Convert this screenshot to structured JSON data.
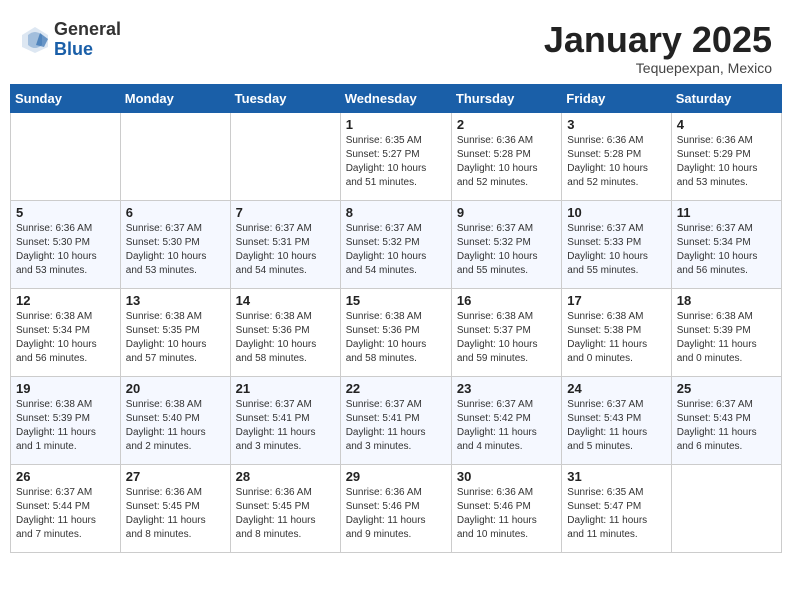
{
  "header": {
    "logo_general": "General",
    "logo_blue": "Blue",
    "month_title": "January 2025",
    "subtitle": "Tequepexpan, Mexico"
  },
  "days_of_week": [
    "Sunday",
    "Monday",
    "Tuesday",
    "Wednesday",
    "Thursday",
    "Friday",
    "Saturday"
  ],
  "weeks": [
    [
      {
        "day": "",
        "info": ""
      },
      {
        "day": "",
        "info": ""
      },
      {
        "day": "",
        "info": ""
      },
      {
        "day": "1",
        "info": "Sunrise: 6:35 AM\nSunset: 5:27 PM\nDaylight: 10 hours\nand 51 minutes."
      },
      {
        "day": "2",
        "info": "Sunrise: 6:36 AM\nSunset: 5:28 PM\nDaylight: 10 hours\nand 52 minutes."
      },
      {
        "day": "3",
        "info": "Sunrise: 6:36 AM\nSunset: 5:28 PM\nDaylight: 10 hours\nand 52 minutes."
      },
      {
        "day": "4",
        "info": "Sunrise: 6:36 AM\nSunset: 5:29 PM\nDaylight: 10 hours\nand 53 minutes."
      }
    ],
    [
      {
        "day": "5",
        "info": "Sunrise: 6:36 AM\nSunset: 5:30 PM\nDaylight: 10 hours\nand 53 minutes."
      },
      {
        "day": "6",
        "info": "Sunrise: 6:37 AM\nSunset: 5:30 PM\nDaylight: 10 hours\nand 53 minutes."
      },
      {
        "day": "7",
        "info": "Sunrise: 6:37 AM\nSunset: 5:31 PM\nDaylight: 10 hours\nand 54 minutes."
      },
      {
        "day": "8",
        "info": "Sunrise: 6:37 AM\nSunset: 5:32 PM\nDaylight: 10 hours\nand 54 minutes."
      },
      {
        "day": "9",
        "info": "Sunrise: 6:37 AM\nSunset: 5:32 PM\nDaylight: 10 hours\nand 55 minutes."
      },
      {
        "day": "10",
        "info": "Sunrise: 6:37 AM\nSunset: 5:33 PM\nDaylight: 10 hours\nand 55 minutes."
      },
      {
        "day": "11",
        "info": "Sunrise: 6:37 AM\nSunset: 5:34 PM\nDaylight: 10 hours\nand 56 minutes."
      }
    ],
    [
      {
        "day": "12",
        "info": "Sunrise: 6:38 AM\nSunset: 5:34 PM\nDaylight: 10 hours\nand 56 minutes."
      },
      {
        "day": "13",
        "info": "Sunrise: 6:38 AM\nSunset: 5:35 PM\nDaylight: 10 hours\nand 57 minutes."
      },
      {
        "day": "14",
        "info": "Sunrise: 6:38 AM\nSunset: 5:36 PM\nDaylight: 10 hours\nand 58 minutes."
      },
      {
        "day": "15",
        "info": "Sunrise: 6:38 AM\nSunset: 5:36 PM\nDaylight: 10 hours\nand 58 minutes."
      },
      {
        "day": "16",
        "info": "Sunrise: 6:38 AM\nSunset: 5:37 PM\nDaylight: 10 hours\nand 59 minutes."
      },
      {
        "day": "17",
        "info": "Sunrise: 6:38 AM\nSunset: 5:38 PM\nDaylight: 11 hours\nand 0 minutes."
      },
      {
        "day": "18",
        "info": "Sunrise: 6:38 AM\nSunset: 5:39 PM\nDaylight: 11 hours\nand 0 minutes."
      }
    ],
    [
      {
        "day": "19",
        "info": "Sunrise: 6:38 AM\nSunset: 5:39 PM\nDaylight: 11 hours\nand 1 minute."
      },
      {
        "day": "20",
        "info": "Sunrise: 6:38 AM\nSunset: 5:40 PM\nDaylight: 11 hours\nand 2 minutes."
      },
      {
        "day": "21",
        "info": "Sunrise: 6:37 AM\nSunset: 5:41 PM\nDaylight: 11 hours\nand 3 minutes."
      },
      {
        "day": "22",
        "info": "Sunrise: 6:37 AM\nSunset: 5:41 PM\nDaylight: 11 hours\nand 3 minutes."
      },
      {
        "day": "23",
        "info": "Sunrise: 6:37 AM\nSunset: 5:42 PM\nDaylight: 11 hours\nand 4 minutes."
      },
      {
        "day": "24",
        "info": "Sunrise: 6:37 AM\nSunset: 5:43 PM\nDaylight: 11 hours\nand 5 minutes."
      },
      {
        "day": "25",
        "info": "Sunrise: 6:37 AM\nSunset: 5:43 PM\nDaylight: 11 hours\nand 6 minutes."
      }
    ],
    [
      {
        "day": "26",
        "info": "Sunrise: 6:37 AM\nSunset: 5:44 PM\nDaylight: 11 hours\nand 7 minutes."
      },
      {
        "day": "27",
        "info": "Sunrise: 6:36 AM\nSunset: 5:45 PM\nDaylight: 11 hours\nand 8 minutes."
      },
      {
        "day": "28",
        "info": "Sunrise: 6:36 AM\nSunset: 5:45 PM\nDaylight: 11 hours\nand 8 minutes."
      },
      {
        "day": "29",
        "info": "Sunrise: 6:36 AM\nSunset: 5:46 PM\nDaylight: 11 hours\nand 9 minutes."
      },
      {
        "day": "30",
        "info": "Sunrise: 6:36 AM\nSunset: 5:46 PM\nDaylight: 11 hours\nand 10 minutes."
      },
      {
        "day": "31",
        "info": "Sunrise: 6:35 AM\nSunset: 5:47 PM\nDaylight: 11 hours\nand 11 minutes."
      },
      {
        "day": "",
        "info": ""
      }
    ]
  ]
}
